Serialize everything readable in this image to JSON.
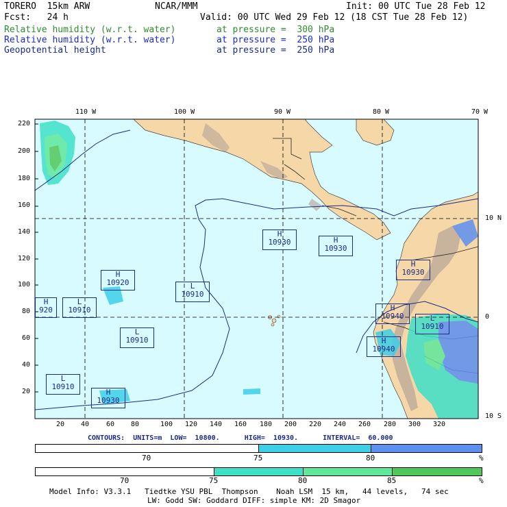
{
  "header": {
    "model": "TORERO  15km ARW",
    "center": "NCAR/MMM",
    "init": "Init: 00 UTC Tue 28 Feb 12",
    "fcst": "Fcst:   24 h",
    "valid": "Valid: 00 UTC Wed 29 Feb 12 (18 CST Tue 28 Feb 12)"
  },
  "fields": [
    {
      "name": "Relative humidity (w.r.t. water)",
      "level": "at pressure =  300 hPa",
      "color": "#2e8b2e"
    },
    {
      "name": "Relative humidity (w.r.t. water)",
      "level": "at pressure =  250 hPa",
      "color": "#1a2acc"
    },
    {
      "name": "Geopotential height",
      "level": "at pressure =  250 hPa",
      "color": "#1a2a8a"
    }
  ],
  "lon_labels": [
    "110 W",
    "100 W",
    "90 W",
    "80 W",
    "70 W"
  ],
  "lat_labels": [
    "10 N",
    "0",
    "10 S"
  ],
  "y_ticks": [
    "220",
    "200",
    "180",
    "160",
    "140",
    "120",
    "100",
    "80",
    "60",
    "40",
    "20"
  ],
  "x_ticks": [
    "20",
    "40",
    "60",
    "80",
    "100",
    "120",
    "140",
    "160",
    "180",
    "200",
    "220",
    "240",
    "260",
    "280",
    "300",
    "320"
  ],
  "centers": [
    {
      "type": "H",
      "value": "10930"
    },
    {
      "type": "H",
      "value": "10930"
    },
    {
      "type": "H",
      "value": "10930"
    },
    {
      "type": "H",
      "value": "10920"
    },
    {
      "type": "L",
      "value": "10910"
    },
    {
      "type": "H",
      "value": "920"
    },
    {
      "type": "L",
      "value": "10910"
    },
    {
      "type": "H",
      "value": "10940"
    },
    {
      "type": "L",
      "value": "10910"
    },
    {
      "type": "L",
      "value": "10910"
    },
    {
      "type": "L",
      "value": "10910"
    },
    {
      "type": "H",
      "value": "10930"
    },
    {
      "type": "H",
      "value": "10940"
    }
  ],
  "contours_text": "CONTOURS:  UNITS=m  LOW=  10800.      HIGH=  10930.      INTERVAL=  60.000",
  "colorbar1": {
    "labels": [
      "70",
      "75",
      "80",
      "%"
    ],
    "colors": [
      "#ffffff",
      "#3ccfe8",
      "#5b8ff0"
    ]
  },
  "colorbar2": {
    "labels": [
      "70",
      "75",
      "80",
      "85",
      "%"
    ],
    "colors": [
      "#ffffff",
      "#3fe0c8",
      "#5fe89a",
      "#4fc85a"
    ]
  },
  "footer": {
    "line1": "Model Info: V3.3.1   Tiedtke YSU PBL  Thompson    Noah LSM  15 km,   44 levels,   74 sec",
    "line2": "LW: Godd SW: Goddard DIFF: simple KM: 2D Smagor"
  },
  "colors": {
    "ocean": "#d8fbff",
    "land": "#f5d7a8",
    "terrain": "#b09b8a",
    "grid": "#000000",
    "contour": "#1a2a8a"
  }
}
